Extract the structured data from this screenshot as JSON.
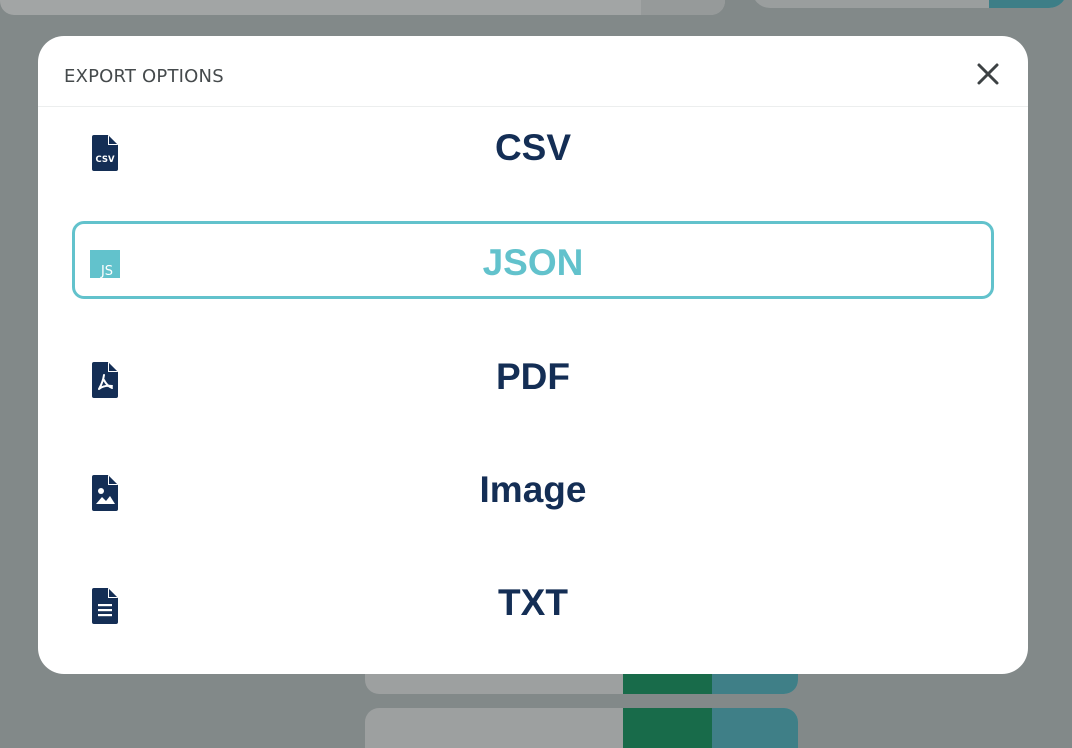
{
  "colors": {
    "backdrop": "#828989",
    "modal_bg": "#ffffff",
    "text_primary": "#142e55",
    "accent_selected": "#62c2cc",
    "title_text": "#454a4c"
  },
  "modal": {
    "title": "EXPORT OPTIONS",
    "close_icon": "close-icon",
    "selected_option": "JSON",
    "options": [
      {
        "label": "CSV",
        "icon": "csv-file-icon",
        "icon_text": "CSV"
      },
      {
        "label": "JSON",
        "icon": "json-file-icon",
        "icon_text": "JS"
      },
      {
        "label": "PDF",
        "icon": "pdf-file-icon"
      },
      {
        "label": "Image",
        "icon": "image-file-icon"
      },
      {
        "label": "TXT",
        "icon": "text-file-icon"
      }
    ]
  }
}
